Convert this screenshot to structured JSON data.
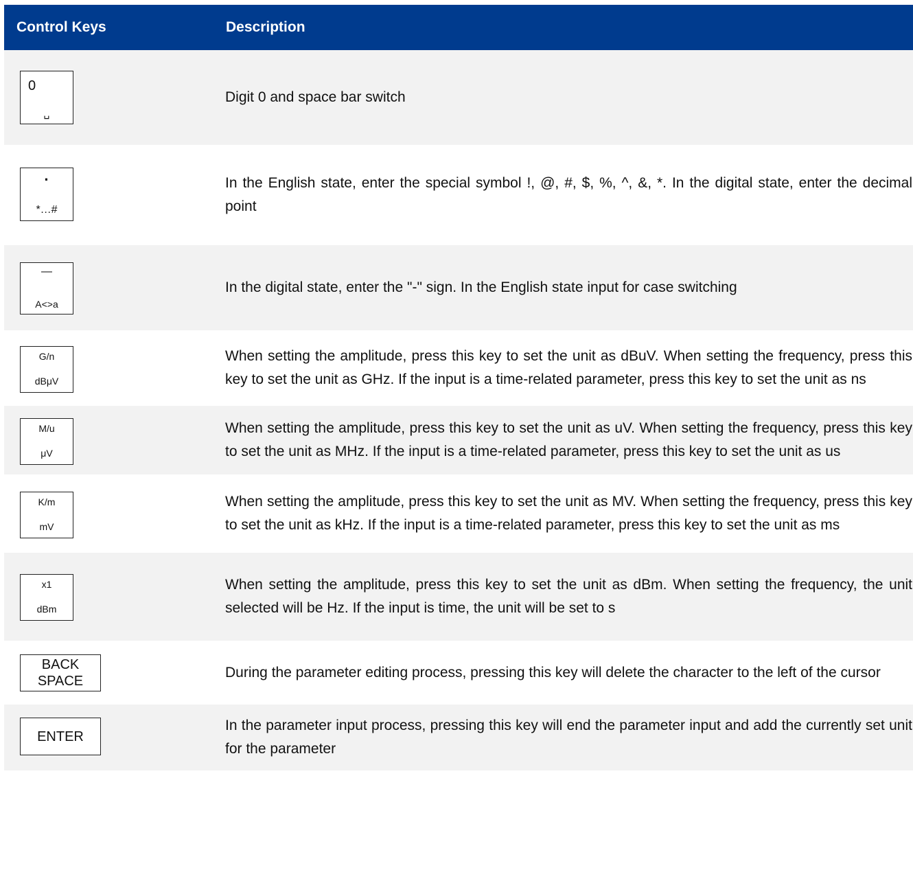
{
  "header": {
    "col1": "Control Keys",
    "col2": "Description"
  },
  "rows": [
    {
      "key_top": "0",
      "key_bottom": "␣",
      "description": "Digit 0 and space bar switch"
    },
    {
      "key_top": "·",
      "key_bottom": "*…#",
      "description": "In the English state, enter the special symbol !, @, #, $, %, ^, &, *. In the digital state, enter the decimal point"
    },
    {
      "key_top": "—",
      "key_bottom": "A<>a",
      "description": "In the digital state, enter the \"-\" sign. In the English state input for case switching"
    },
    {
      "key_top": "G/n",
      "key_bottom": "dBμV",
      "description": "When setting the amplitude, press this key to set the unit as dBuV.   When setting the frequency, press this key to set the unit as GHz. If the input is a time-related parameter, press this key to set the unit as ns"
    },
    {
      "key_top": "M/u",
      "key_bottom": "μV",
      "description": "When setting the amplitude, press this key to set the unit as uV. When setting the frequency, press this key to set the unit as MHz. If the input is a time-related parameter, press this key to set the unit as us"
    },
    {
      "key_top": "K/m",
      "key_bottom": "mV",
      "description": "When setting the amplitude, press this key to set the unit as MV. When setting the frequency, press this key to set the unit as kHz. If the input is a time-related parameter, press this key to set the unit as ms"
    },
    {
      "key_top": "x1",
      "key_bottom": "dBm",
      "description": "When setting the amplitude, press this key to set the unit as dBm. When setting the frequency, the unit selected will be Hz. If the input is time, the unit will be set to s"
    },
    {
      "key_top": "BACK",
      "key_bottom": "SPACE",
      "description": "During the parameter editing process, pressing this key will delete the character to the left of the cursor"
    },
    {
      "key_label": "ENTER",
      "description": "In the parameter input process, pressing this key will end the parameter input and add the currently set unit for the parameter"
    }
  ]
}
